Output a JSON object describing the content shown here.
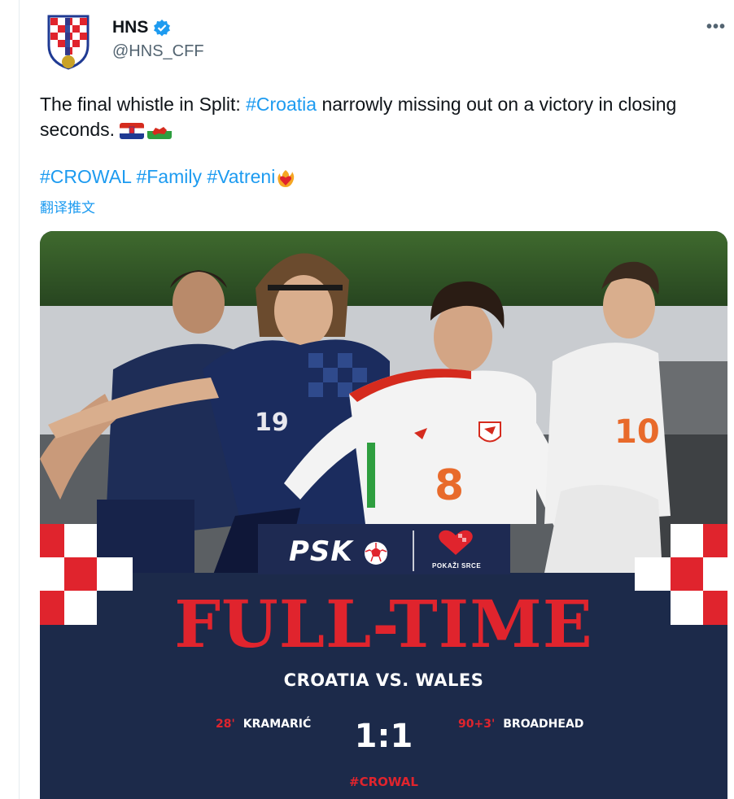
{
  "author": {
    "name": "HNS",
    "handle": "@HNS_CFF",
    "avatar_icon": "croatia-crest-icon",
    "verified_icon": "verified-badge-icon",
    "more_label": "•••"
  },
  "tweet": {
    "text_before": "The final whistle in Split: ",
    "hashtag_croatia": "#Croatia",
    "text_after": " narrowly missing out on a victory in closing seconds. ",
    "hashtags": [
      "#CROWAL",
      "#Family",
      "#Vatreni"
    ],
    "translate_label": "翻译推文"
  },
  "graphic": {
    "sponsor": "PSK",
    "sponsor2": "POKAŽI SRCE",
    "headline": "FULL-TIME",
    "matchup": "CROATIA VS. WALES",
    "home_scorer": {
      "minute": "28'",
      "name": "KRAMARIĆ"
    },
    "away_scorer": {
      "minute": "90+3'",
      "name": "BROADHEAD"
    },
    "score": "1:1",
    "tag": "#CROWAL"
  },
  "colors": {
    "link": "#1d9bf0",
    "navy": "#1c2a4a",
    "red": "#e0242d"
  }
}
